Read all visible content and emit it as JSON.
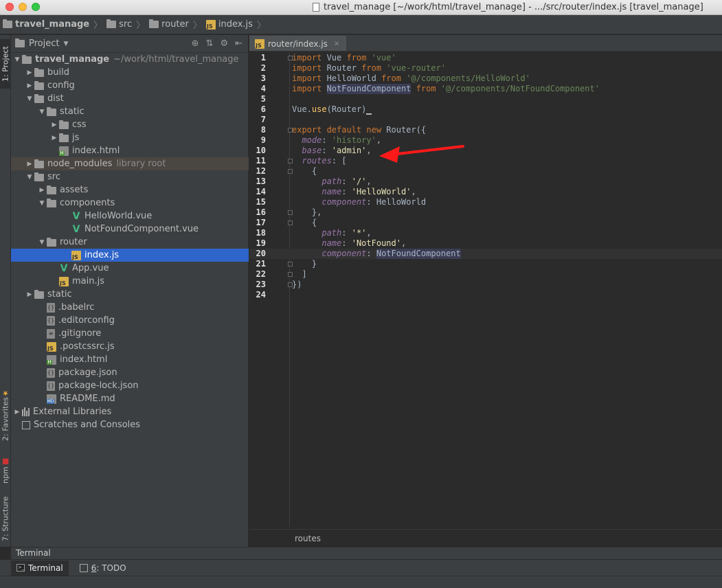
{
  "window": {
    "title": "travel_manage [~/work/html/travel_manage] - .../src/router/index.js [travel_manage]"
  },
  "breadcrumb": [
    "travel_manage",
    "src",
    "router",
    "index.js"
  ],
  "left_strip": {
    "project_tab": "1: Project",
    "favorites_tab": "2: Favorites",
    "npm_tab": "npm",
    "structure_tab": "7: Structure"
  },
  "project_panel": {
    "title": "Project",
    "tree": [
      {
        "label": "travel_manage",
        "extra": "~/work/html/travel_manage",
        "depth": 0,
        "arrow": "open",
        "icon": "folder-icon",
        "bold": true
      },
      {
        "label": "build",
        "depth": 1,
        "arrow": "closed",
        "icon": "folder-icon"
      },
      {
        "label": "config",
        "depth": 1,
        "arrow": "closed",
        "icon": "folder-icon"
      },
      {
        "label": "dist",
        "depth": 1,
        "arrow": "open",
        "icon": "folder-icon"
      },
      {
        "label": "static",
        "depth": 2,
        "arrow": "open",
        "icon": "folder-icon"
      },
      {
        "label": "css",
        "depth": 3,
        "arrow": "closed",
        "icon": "folder-icon"
      },
      {
        "label": "js",
        "depth": 3,
        "arrow": "closed",
        "icon": "folder-icon"
      },
      {
        "label": "index.html",
        "depth": 3,
        "arrow": "none",
        "icon": "html-file-icon"
      },
      {
        "label": "node_modules",
        "extra": "library root",
        "depth": 1,
        "arrow": "closed",
        "icon": "folder-icon",
        "highlight": true
      },
      {
        "label": "src",
        "depth": 1,
        "arrow": "open",
        "icon": "folder-icon"
      },
      {
        "label": "assets",
        "depth": 2,
        "arrow": "closed",
        "icon": "folder-icon"
      },
      {
        "label": "components",
        "depth": 2,
        "arrow": "open",
        "icon": "folder-icon"
      },
      {
        "label": "HelloWorld.vue",
        "depth": 4,
        "arrow": "none",
        "icon": "vue-file-icon"
      },
      {
        "label": "NotFoundComponent.vue",
        "depth": 4,
        "arrow": "none",
        "icon": "vue-file-icon"
      },
      {
        "label": "router",
        "depth": 2,
        "arrow": "open",
        "icon": "folder-icon"
      },
      {
        "label": "index.js",
        "depth": 4,
        "arrow": "none",
        "icon": "js-file-icon",
        "selected": true
      },
      {
        "label": "App.vue",
        "depth": 3,
        "arrow": "none",
        "icon": "vue-file-icon"
      },
      {
        "label": "main.js",
        "depth": 3,
        "arrow": "none",
        "icon": "js-file-icon"
      },
      {
        "label": "static",
        "depth": 1,
        "arrow": "closed",
        "icon": "folder-icon"
      },
      {
        "label": ".babelrc",
        "depth": 2,
        "arrow": "none",
        "icon": "config-file-icon"
      },
      {
        "label": ".editorconfig",
        "depth": 2,
        "arrow": "none",
        "icon": "config-file-icon"
      },
      {
        "label": ".gitignore",
        "depth": 2,
        "arrow": "none",
        "icon": "text-file-icon"
      },
      {
        "label": ".postcssrc.js",
        "depth": 2,
        "arrow": "none",
        "icon": "js-file-icon"
      },
      {
        "label": "index.html",
        "depth": 2,
        "arrow": "none",
        "icon": "html-file-icon"
      },
      {
        "label": "package.json",
        "depth": 2,
        "arrow": "none",
        "icon": "json-file-icon"
      },
      {
        "label": "package-lock.json",
        "depth": 2,
        "arrow": "none",
        "icon": "json-file-icon"
      },
      {
        "label": "README.md",
        "depth": 2,
        "arrow": "none",
        "icon": "markdown-file-icon"
      },
      {
        "label": "External Libraries",
        "depth": 0,
        "arrow": "closed",
        "icon": "library-icon"
      },
      {
        "label": "Scratches and Consoles",
        "depth": 0,
        "arrow": "none",
        "icon": "scratches-icon"
      }
    ]
  },
  "editor": {
    "tab_label": "router/index.js",
    "current_line": 20,
    "status_text": "routes",
    "lines": [
      [
        [
          "k",
          "import "
        ],
        [
          "t",
          "Vue "
        ],
        [
          "k",
          "from "
        ],
        [
          "s",
          "'vue'"
        ]
      ],
      [
        [
          "k",
          "import "
        ],
        [
          "t",
          "Router "
        ],
        [
          "k",
          "from "
        ],
        [
          "s",
          "'vue-router'"
        ]
      ],
      [
        [
          "k",
          "import "
        ],
        [
          "t",
          "HelloWorld "
        ],
        [
          "k",
          "from "
        ],
        [
          "s",
          "'@/components/HelloWorld'"
        ]
      ],
      [
        [
          "k",
          "import "
        ],
        [
          "h",
          "NotFoundComponent"
        ],
        [
          "t",
          " "
        ],
        [
          "k",
          "from "
        ],
        [
          "s",
          "'@/components/NotFoundComponent'"
        ]
      ],
      [],
      [
        [
          "t",
          "Vue."
        ],
        [
          "f",
          "use"
        ],
        [
          "t",
          "(Router)"
        ],
        [
          "c",
          "_"
        ]
      ],
      [],
      [
        [
          "k",
          "export default new "
        ],
        [
          "t",
          "Router({"
        ]
      ],
      [
        [
          "t",
          "  "
        ],
        [
          "p",
          "mode"
        ],
        [
          "t",
          ": "
        ],
        [
          "s",
          "'history'"
        ],
        [
          "t",
          ","
        ]
      ],
      [
        [
          "t",
          "  "
        ],
        [
          "p",
          "base"
        ],
        [
          "t",
          ": "
        ],
        [
          "s2",
          "'admin'"
        ],
        [
          "t",
          ","
        ]
      ],
      [
        [
          "t",
          "  "
        ],
        [
          "p",
          "routes"
        ],
        [
          "t",
          ": ["
        ]
      ],
      [
        [
          "t",
          "    {"
        ]
      ],
      [
        [
          "t",
          "      "
        ],
        [
          "p",
          "path"
        ],
        [
          "t",
          ": "
        ],
        [
          "s2",
          "'/'"
        ],
        [
          "t",
          ","
        ]
      ],
      [
        [
          "t",
          "      "
        ],
        [
          "p",
          "name"
        ],
        [
          "t",
          ": "
        ],
        [
          "s2",
          "'HelloWorld'"
        ],
        [
          "t",
          ","
        ]
      ],
      [
        [
          "t",
          "      "
        ],
        [
          "p",
          "component"
        ],
        [
          "t",
          ": HelloWorld"
        ]
      ],
      [
        [
          "t",
          "    },"
        ]
      ],
      [
        [
          "t",
          "    {"
        ]
      ],
      [
        [
          "t",
          "      "
        ],
        [
          "p",
          "path"
        ],
        [
          "t",
          ": "
        ],
        [
          "s2",
          "'*'"
        ],
        [
          "t",
          ","
        ]
      ],
      [
        [
          "t",
          "      "
        ],
        [
          "p",
          "name"
        ],
        [
          "t",
          ": "
        ],
        [
          "s2",
          "'NotFound'"
        ],
        [
          "t",
          ","
        ]
      ],
      [
        [
          "t",
          "      "
        ],
        [
          "p",
          "component"
        ],
        [
          "t",
          ": "
        ],
        [
          "h",
          "NotFoundComponent"
        ]
      ],
      [
        [
          "t",
          "    }"
        ]
      ],
      [
        [
          "t",
          "  ]"
        ]
      ],
      [
        [
          "t",
          "})"
        ]
      ],
      []
    ]
  },
  "terminal_panel": {
    "title": "Terminal"
  },
  "bottom_tabs": [
    {
      "prefix": "",
      "label": "Terminal",
      "icon": "terminal-icon",
      "active": true
    },
    {
      "prefix": "6",
      "label": ": TODO",
      "icon": "todo-icon",
      "active": false
    }
  ],
  "colors": {
    "keyword": "#cc7832",
    "string": "#6a8759",
    "property": "#9876aa",
    "selection": "#2f65ca",
    "annotation_arrow": "#ff1a1a"
  }
}
